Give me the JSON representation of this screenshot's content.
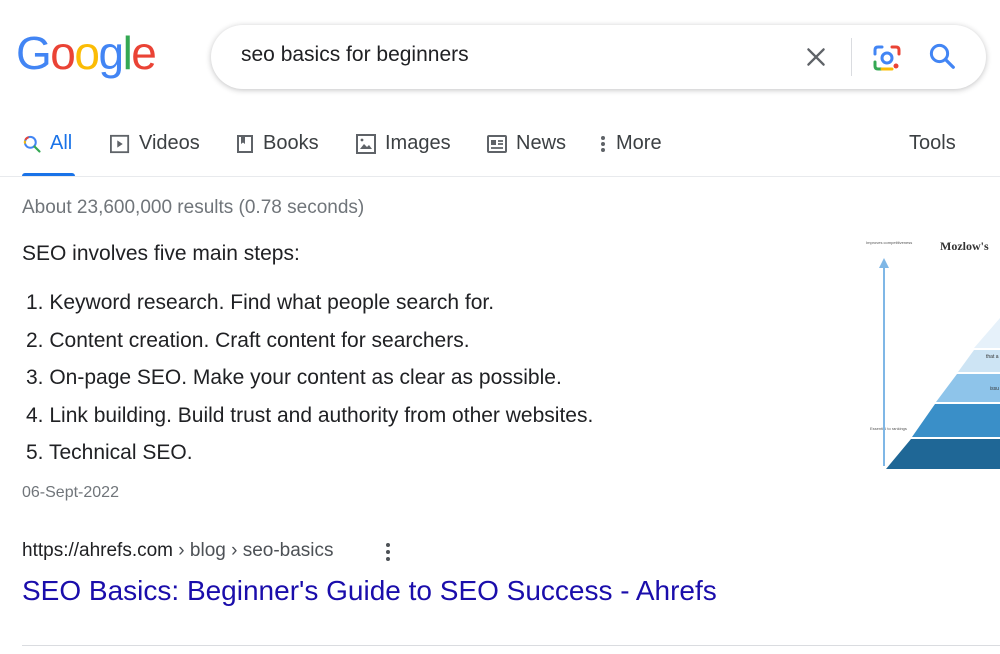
{
  "logo": {
    "letters": [
      "G",
      "o",
      "o",
      "g",
      "l",
      "e"
    ],
    "colors": [
      "#4285F4",
      "#EA4335",
      "#FBBC05",
      "#4285F4",
      "#34A853",
      "#EA4335"
    ]
  },
  "search": {
    "query": "seo basics for beginners"
  },
  "tabs": [
    {
      "label": "All",
      "icon": "search-icon",
      "active": true
    },
    {
      "label": "Videos",
      "icon": "video-icon"
    },
    {
      "label": "Books",
      "icon": "book-icon"
    },
    {
      "label": "Images",
      "icon": "image-icon"
    },
    {
      "label": "News",
      "icon": "news-icon"
    },
    {
      "label": "More",
      "icon": "more-vertical-icon"
    }
  ],
  "tools_label": "Tools",
  "results_stats": "About 23,600,000 results (0.78 seconds)",
  "featured_snippet": {
    "heading": "SEO involves five main steps:",
    "steps": [
      "1. Keyword research. Find what people search for.",
      "2. Content creation. Craft content for searchers.",
      "3. On-page SEO. Make your content as clear as possible.",
      "4. Link building. Build trust and authority from other websites.",
      "5. Technical SEO."
    ],
    "date": "06-Sept-2022",
    "thumbnail": {
      "title": "Mozlow's",
      "top_label": "Improves competitiveness",
      "bottom_label": "Essential to rankings"
    }
  },
  "result": {
    "url_base": "https://ahrefs.com",
    "breadcrumbs": " › blog › seo-basics",
    "title": "SEO Basics: Beginner's Guide to SEO Success - Ahrefs"
  },
  "colors": {
    "link": "#1a0dab",
    "accent": "#1a73e8",
    "muted": "#70757a"
  }
}
